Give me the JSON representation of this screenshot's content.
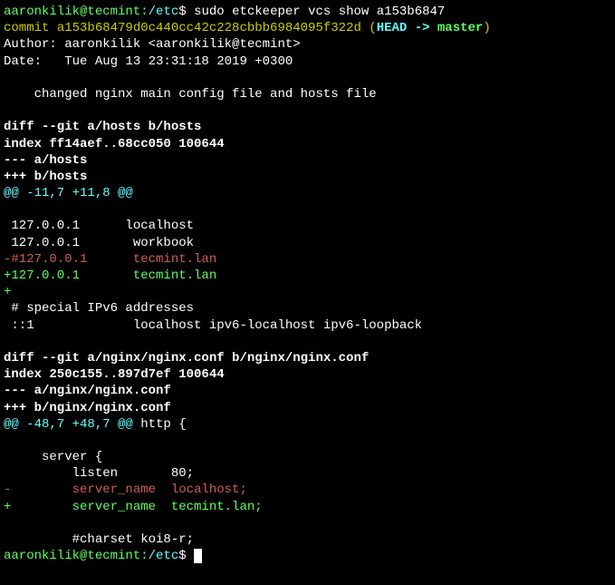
{
  "prompt1": {
    "user_host": "aaronkilik@tecmint",
    "path": ":/etc",
    "dollar": "$ ",
    "command": "sudo etckeeper vcs show a153b6847"
  },
  "commit_line": {
    "label": "commit ",
    "hash": "a153b68479d0c440cc42c228cbbb6984095f322d",
    "open_paren": " (",
    "head_arrow": "HEAD -> ",
    "master": "master",
    "close_paren": ")"
  },
  "author_line": "Author: aaronkilik <aaronkilik@tecmint>",
  "date_line": "Date:   Tue Aug 13 23:31:18 2019 +0300",
  "blank1": "",
  "commit_msg": "    changed nginx main config file and hosts file",
  "blank2": "",
  "diff1": {
    "header": "diff --git a/hosts b/hosts",
    "index": "index ff14aef..68cc050 100644",
    "minus_file": "--- a/hosts",
    "plus_file": "+++ b/hosts",
    "hunk": "@@ -11,7 +11,8 @@",
    "blank": "",
    "ctx1": " 127.0.0.1      localhost",
    "ctx2": " 127.0.0.1       workbook",
    "removed": "-#127.0.0.1      tecmint.lan",
    "added1": "+127.0.0.1       tecmint.lan",
    "added2": "+",
    "ctx3": " # special IPv6 addresses",
    "ctx4": " ::1             localhost ipv6-localhost ipv6-loopback",
    "blank_after": ""
  },
  "diff2": {
    "header": "diff --git a/nginx/nginx.conf b/nginx/nginx.conf",
    "index": "index 250c155..897d7ef 100644",
    "minus_file": "--- a/nginx/nginx.conf",
    "plus_file": "+++ b/nginx/nginx.conf",
    "hunk_prefix": "@@ -48,7 +48,7 @@",
    "hunk_suffix": " http {",
    "blank": "",
    "ctx1": "     server {",
    "ctx2": "         listen       80;",
    "removed": "-        server_name  localhost;",
    "added": "+        server_name  tecmint.lan;",
    "blank2": "",
    "ctx3": "         #charset koi8-r;"
  },
  "prompt2": {
    "user_host": "aaronkilik@tecmint",
    "path": ":/etc",
    "dollar": "$ "
  },
  "chart_data": null
}
